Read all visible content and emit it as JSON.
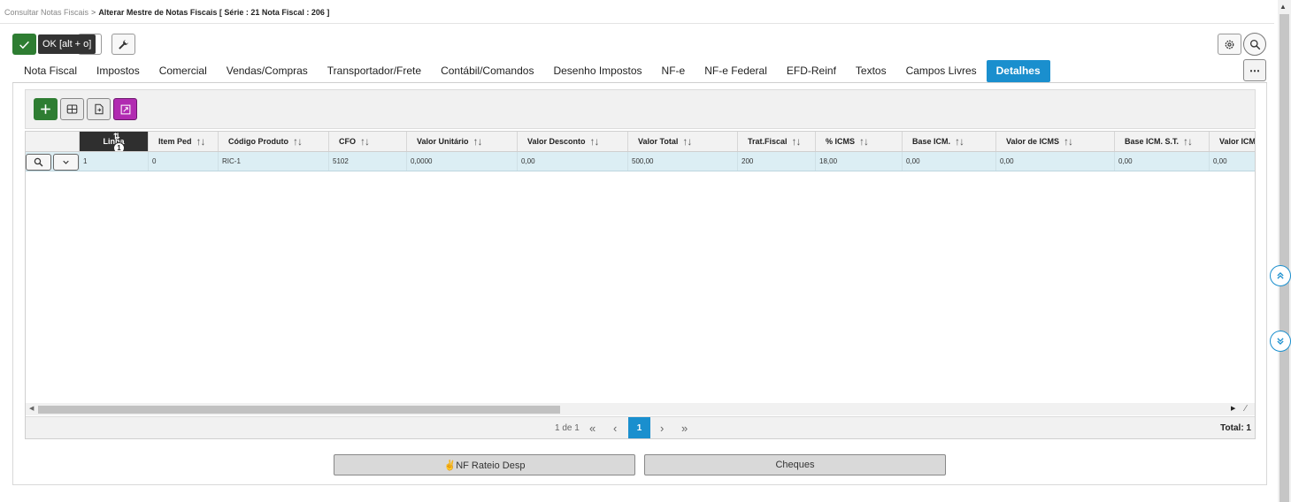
{
  "breadcrumb": {
    "parent": "Consultar Notas Fiscais",
    "separator": ">",
    "current": "Alterar Mestre de Notas Fiscais [ Série : 21 Nota Fiscal : 206 ]"
  },
  "toolbar": {
    "ok_tooltip": "OK [alt + o]"
  },
  "tabs": [
    {
      "label": "Nota Fiscal"
    },
    {
      "label": "Impostos"
    },
    {
      "label": "Comercial"
    },
    {
      "label": "Vendas/Compras"
    },
    {
      "label": "Transportador/Frete"
    },
    {
      "label": "Contábil/Comandos"
    },
    {
      "label": "Desenho Impostos"
    },
    {
      "label": "NF-e"
    },
    {
      "label": "NF-e Federal"
    },
    {
      "label": "EFD-Reinf"
    },
    {
      "label": "Textos"
    },
    {
      "label": "Campos Livres"
    },
    {
      "label": "Detalhes",
      "active": true
    }
  ],
  "more_label": "⋯",
  "grid": {
    "sort_badge": "1",
    "columns": [
      "Linha",
      "Item Ped",
      "Código Produto",
      "CFO",
      "Valor Unitário",
      "Valor Desconto",
      "Valor Total",
      "Trat.Fiscal",
      "% ICMS",
      "Base ICM.",
      "Valor de ICMS",
      "Base ICM. S.T.",
      "Valor ICMS"
    ],
    "rows": [
      [
        "1",
        "0",
        "RIC-1",
        "5102",
        "0,0000",
        "0,00",
        "500,00",
        "200",
        "18,00",
        "0,00",
        "0,00",
        "0,00",
        "0,00"
      ]
    ]
  },
  "pager": {
    "info": "1 de 1",
    "first": "«",
    "prev": "‹",
    "current": "1",
    "next": "›",
    "last": "»",
    "total": "Total: 1"
  },
  "buttons": {
    "rateio": "✌NF Rateio Desp",
    "cheques": "Cheques"
  },
  "colors": {
    "accent": "#1a8fce",
    "ok_green": "#2e7d32",
    "expand_purple": "#b12bb1",
    "row_highlight": "#dceef4"
  },
  "icons": [
    "check-icon",
    "wrench-icon",
    "gear-icon",
    "search-icon",
    "more-icon",
    "plus-icon",
    "grid-icon",
    "export-icon",
    "expand-icon",
    "chevron-down-icon",
    "scroll-up-icon",
    "scroll-down-icon"
  ]
}
